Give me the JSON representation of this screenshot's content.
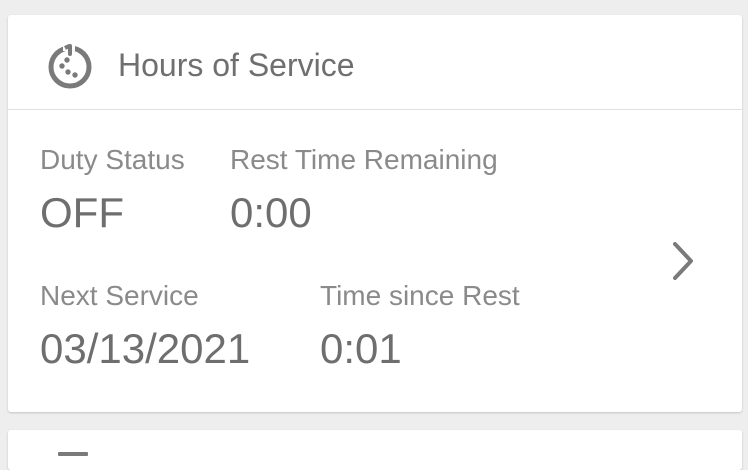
{
  "card": {
    "title": "Hours of Service",
    "icon": "clock-progress-icon",
    "fields": {
      "duty_status_label": "Duty Status",
      "duty_status_value": "OFF",
      "rest_time_label": "Rest Time Remaining",
      "rest_time_value": "0:00",
      "next_service_label": "Next Service",
      "next_service_value": "03/13/2021",
      "time_since_rest_label": "Time since Rest",
      "time_since_rest_value": "0:01"
    },
    "chevron_icon": "chevron-right-icon"
  }
}
